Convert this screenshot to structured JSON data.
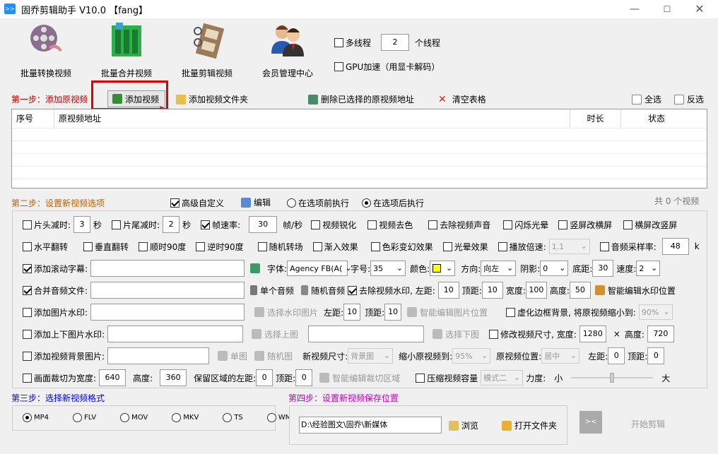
{
  "window": {
    "title": "固乔剪辑助手 V10.0 【fang】",
    "app_icon": ">>"
  },
  "toolbar": [
    {
      "label": "批量转换视频",
      "icon": "film-reel-icon"
    },
    {
      "label": "批量合并视频",
      "icon": "merge-film-icon"
    },
    {
      "label": "批量剪辑视频",
      "icon": "clip-film-icon"
    },
    {
      "label": "会员管理中心",
      "icon": "members-icon"
    }
  ],
  "thread": {
    "multi_label": "多线程",
    "count": "2",
    "unit_label": "个线程",
    "gpu_label": "GPU加速（用显卡解码）"
  },
  "step1": {
    "title": "第一步：添加原视频",
    "add_video": "添加视频",
    "add_folder": "添加视频文件夹",
    "delete_selected": "删除已选择的原视频地址",
    "clear_table": "清空表格",
    "select_all": "全选",
    "invert": "反选"
  },
  "table": {
    "columns": [
      "序号",
      "原视频地址",
      "时长",
      "状态"
    ]
  },
  "step2": {
    "title": "第二步：设置新视频选项",
    "advanced": "高级自定义",
    "edit": "编辑",
    "before": "在选项前执行",
    "after": "在选项后执行",
    "count_text": "共 0 个视频"
  },
  "r1": {
    "head_cut": "片头减时:",
    "head_val": "3",
    "sec": "秒",
    "tail_cut": "片尾减时:",
    "tail_val": "2",
    "sec2": "秒",
    "fps": "帧速率:",
    "fps_val": "30",
    "fps_unit": "帧/秒",
    "sharpen": "视频锐化",
    "decolor": "视频去色",
    "remove_audio": "去除视频声音",
    "flash": "闪烁光晕",
    "v2h": "竖屏改横屏",
    "h2v": "横屏改竖屏"
  },
  "r2": {
    "hflip": "水平翻转",
    "vflip": "垂直翻转",
    "cw90": "顺时90度",
    "ccw90": "逆时90度",
    "rand_trans": "随机转场",
    "fadein": "渐入效果",
    "color_magic": "色彩变幻效果",
    "halo": "光晕效果",
    "speed": "播放倍速:",
    "speed_val": "1.1",
    "samplerate": "音频采样率:",
    "samplerate_val": "48",
    "k": "k"
  },
  "r3": {
    "subtitle": "添加滚动字幕:",
    "font_label": "字体:",
    "font_val": "Agency FB(A(",
    "size_label": "字号:",
    "size_val": "35",
    "color_label": "颜色:",
    "color_val": "#ffff00",
    "dir_label": "方向:",
    "dir_val": "向左",
    "shadow_label": "阴影:",
    "shadow_val": "0",
    "bottom_label": "底距:",
    "bottom_val": "30",
    "speed_label": "速度:",
    "speed_val": "2"
  },
  "r4": {
    "merge_audio": "合并音频文件:",
    "single": "单个音频",
    "random": "随机音频",
    "remove_wm": "去除视频水印, 左距:",
    "left_val": "10",
    "top_label": "顶距:",
    "top_val": "10",
    "width_label": "宽度:",
    "width_val": "100",
    "height_label": "高度:",
    "height_val": "50",
    "smart": "智能编辑水印位置"
  },
  "r5": {
    "img_wm": "添加图片水印:",
    "choose": "选择水印图片",
    "left_label": "左距:",
    "left_val": "10",
    "top_label": "顶距:",
    "top_val": "10",
    "smart": "智能编辑图片位置",
    "blur": "虚化边框背景, 将原视频缩小到:",
    "blur_val": "90%"
  },
  "r6": {
    "tb_wm": "添加上下图片水印:",
    "up": "选择上图",
    "down": "选择下图",
    "resize": "修改视频尺寸, 宽度:",
    "w_val": "1280",
    "x": "×",
    "h_label": "高度:",
    "h_val": "720"
  },
  "r7": {
    "bg_img": "添加视频背景图片:",
    "single": "单图",
    "random": "随机图",
    "size_label": "新视频尺寸:",
    "size_val": "背景图",
    "shrink_label": "缩小原视频到:",
    "shrink_val": "95%",
    "pos_label": "原视频位置:",
    "pos_val": "居中",
    "left_label": "左距:",
    "left_val": "0",
    "top_label": "顶距:",
    "top_val": "0"
  },
  "r8": {
    "crop": "画面裁切为宽度:",
    "w_val": "640",
    "h_label": "高度:",
    "h_val": "360",
    "keep": "保留区域的左距:",
    "left_val": "0",
    "top_label": "顶距:",
    "top_val": "0",
    "smart": "智能编辑裁切区域",
    "compress": "压缩视频容量",
    "mode_val": "模式二",
    "force": "力度:",
    "small": "小",
    "big": "大",
    "force_level": 0.5
  },
  "step3": {
    "title": "第三步：选择新视频格式",
    "formats": [
      "MP4",
      "FLV",
      "MOV",
      "MKV",
      "TS",
      "WMV"
    ]
  },
  "step4": {
    "title": "第四步：设置新视频保存位置",
    "path": "D:\\经验图文\\固乔\\新媒体",
    "browse": "浏览",
    "open": "打开文件夹",
    "start": "开始剪辑"
  },
  "colors": {
    "accent_blue": "#0000ff",
    "highlight": "#e00000"
  }
}
